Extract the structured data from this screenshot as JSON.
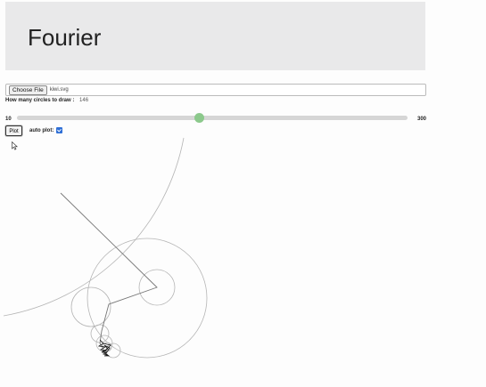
{
  "header": {
    "title": "Fourier"
  },
  "file_input": {
    "button_label": "Choose File",
    "file_name": "kiwi.svg"
  },
  "circles": {
    "label": "How many circles to draw :",
    "value": "146",
    "slider_min": "10",
    "slider_max": "300",
    "slider_fraction": 0.466
  },
  "controls": {
    "plot_label": "Plot",
    "auto_plot_label": "auto plot:",
    "auto_plot_checked": true
  },
  "icons": {
    "cursor": "mouse-pointer-icon",
    "checkbox": "checkmark-icon"
  },
  "colors": {
    "header_bg": "#e9e9ea",
    "slider_thumb": "#8cc98c",
    "slider_track": "#d6d6d6",
    "checkbox": "#2f6fd6"
  }
}
